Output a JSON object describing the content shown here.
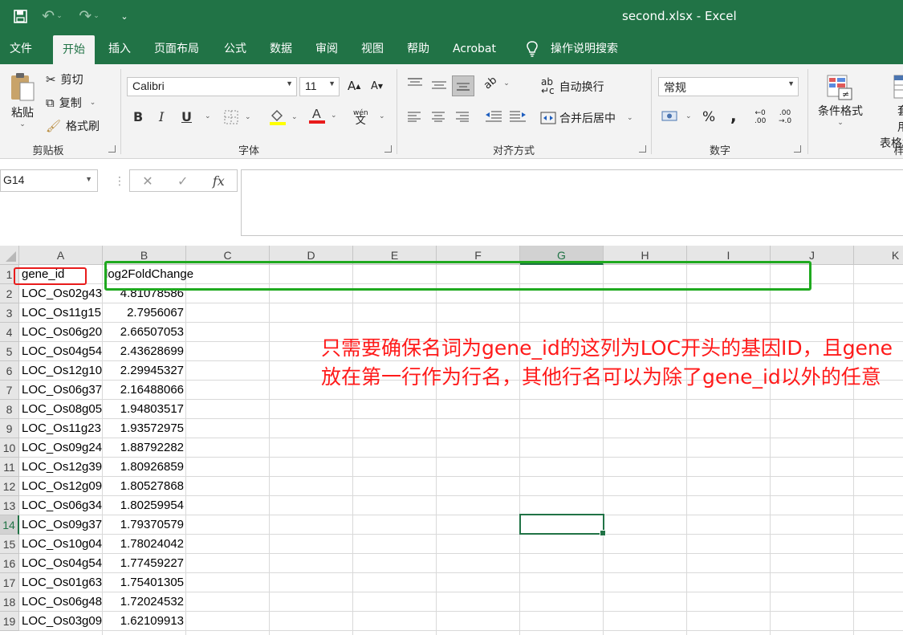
{
  "window": {
    "title": "second.xlsx  -  Excel"
  },
  "ribbon_tabs": [
    "文件",
    "开始",
    "插入",
    "页面布局",
    "公式",
    "数据",
    "审阅",
    "视图",
    "帮助",
    "Acrobat",
    "操作说明搜索"
  ],
  "clipboard": {
    "paste": "粘贴",
    "cut": "剪切",
    "copy": "复制",
    "format_painter": "格式刷",
    "group_label": "剪贴板"
  },
  "font": {
    "name": "Calibri",
    "size": "11",
    "bold": "B",
    "italic": "I",
    "underline": "U",
    "phonetic": "wén",
    "group_label": "字体"
  },
  "alignment": {
    "wrap_text": "自动换行",
    "merge_center": "合并后居中",
    "group_label": "对齐方式"
  },
  "number": {
    "format": "常规",
    "percent": "%",
    "comma": ",",
    "inc_decimal_top": "←0",
    "inc_decimal_bottom": ".00",
    "dec_decimal_top": ".00",
    "dec_decimal_bottom": "→.0",
    "group_label": "数字"
  },
  "styles": {
    "conditional_format": "条件格式",
    "table_format_top": "套用",
    "table_format_bottom": "表格格",
    "group_label": "样"
  },
  "formula_bar": {
    "name_box": "G14",
    "fx": "fx",
    "value": ""
  },
  "sheet": {
    "columns": [
      "A",
      "B",
      "C",
      "D",
      "E",
      "F",
      "G",
      "H",
      "I",
      "J",
      "K"
    ],
    "selected_column": "G",
    "selected_row": "14",
    "rows": [
      {
        "num": "1",
        "a": "gene_id",
        "b": "log2FoldChange"
      },
      {
        "num": "2",
        "a": "LOC_Os02g43",
        "b": "4.81078586"
      },
      {
        "num": "3",
        "a": "LOC_Os11g15",
        "b": "2.7956067"
      },
      {
        "num": "4",
        "a": "LOC_Os06g20",
        "b": "2.66507053"
      },
      {
        "num": "5",
        "a": "LOC_Os04g54",
        "b": "2.43628699"
      },
      {
        "num": "6",
        "a": "LOC_Os12g10",
        "b": "2.29945327"
      },
      {
        "num": "7",
        "a": "LOC_Os06g37",
        "b": "2.16488066"
      },
      {
        "num": "8",
        "a": "LOC_Os08g05",
        "b": "1.94803517"
      },
      {
        "num": "9",
        "a": "LOC_Os11g23",
        "b": "1.93572975"
      },
      {
        "num": "10",
        "a": "LOC_Os09g24",
        "b": "1.88792282"
      },
      {
        "num": "11",
        "a": "LOC_Os12g39",
        "b": "1.80926859"
      },
      {
        "num": "12",
        "a": "LOC_Os12g09",
        "b": "1.80527868"
      },
      {
        "num": "13",
        "a": "LOC_Os06g34",
        "b": "1.80259954"
      },
      {
        "num": "14",
        "a": "LOC_Os09g37",
        "b": "1.79370579"
      },
      {
        "num": "15",
        "a": "LOC_Os10g04",
        "b": "1.78024042"
      },
      {
        "num": "16",
        "a": "LOC_Os04g54",
        "b": "1.77459227"
      },
      {
        "num": "17",
        "a": "LOC_Os01g63",
        "b": "1.75401305"
      },
      {
        "num": "18",
        "a": "LOC_Os06g48",
        "b": "1.72024532"
      },
      {
        "num": "19",
        "a": "LOC_Os03g09",
        "b": "1.62109913"
      }
    ]
  },
  "annotation": {
    "line1": "只需要确保名词为gene_id的这列为LOC开头的基因ID，且gene",
    "line2": "放在第一行作为行名，其他行名可以为除了gene_id以外的任意"
  },
  "colors": {
    "accent": "#217346",
    "annotation_red": "#ff1a1a",
    "highlight_green": "#1fa91f"
  }
}
